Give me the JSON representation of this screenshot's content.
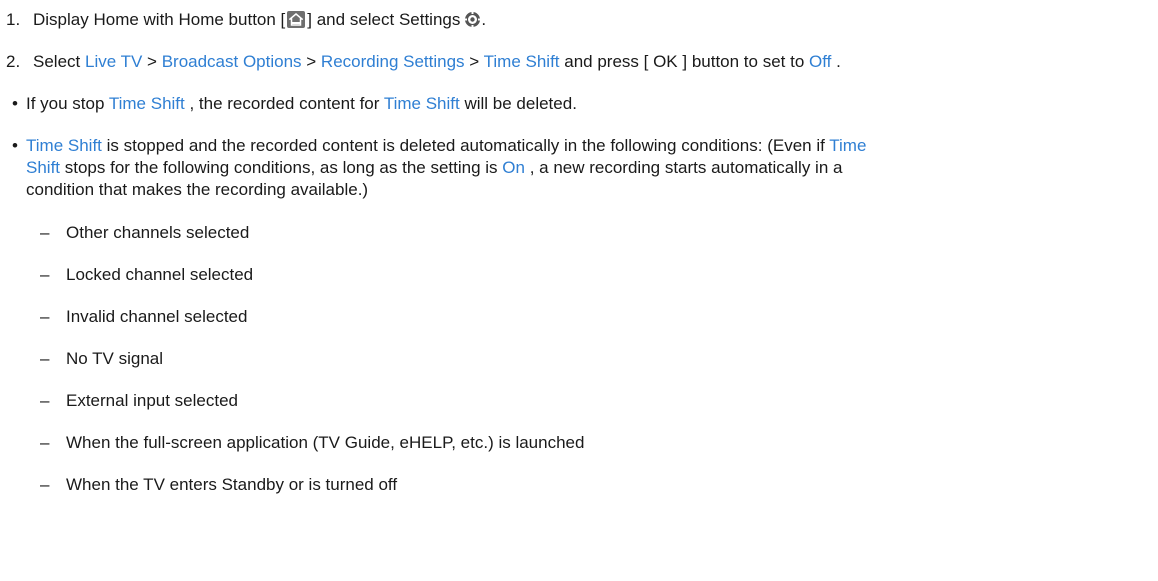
{
  "steps": [
    {
      "num": "1.",
      "t1": "Display Home with Home button [",
      "t2": "] and select Settings",
      "t3": "."
    },
    {
      "num": "2.",
      "t1": "Select ",
      "live_tv": "Live TV",
      "sep1": " > ",
      "broadcast_options": "Broadcast Options",
      "sep2": " > ",
      "recording_settings": "Recording Settings",
      "sep3": " > ",
      "time_shift": "Time Shift",
      "t2": " and press [ OK ] button to set to ",
      "off": "Off",
      "t3": " ."
    }
  ],
  "notes": {
    "bullet": "•",
    "note1": {
      "t1": "If you stop ",
      "ts1": "Time Shift",
      "t2": " , the recorded content for ",
      "ts2": "Time Shift",
      "t3": " will be deleted."
    },
    "note2": {
      "ts1": "Time Shift",
      "t1": " is stopped and the recorded content is deleted automatically in the following conditions: (Even if ",
      "ts2a": "Time",
      "ts2b": "Shift",
      "t2": " stops for the following conditions, as long as the setting is ",
      "on": "On",
      "t3": " , a new recording starts automatically in a",
      "t4": "condition that makes the recording available.)"
    }
  },
  "conditions": {
    "dash": "–",
    "items": [
      "Other channels selected",
      "Locked channel selected",
      "Invalid channel selected",
      "No TV signal",
      "External input selected",
      "When the full-screen application (TV Guide, eHELP, etc.) is launched",
      "When the TV enters Standby or is turned off"
    ]
  },
  "icons": {
    "home": "home-icon",
    "settings": "gear-icon"
  },
  "colors": {
    "link": "#2f7fd3",
    "text": "#1a1a1a"
  }
}
